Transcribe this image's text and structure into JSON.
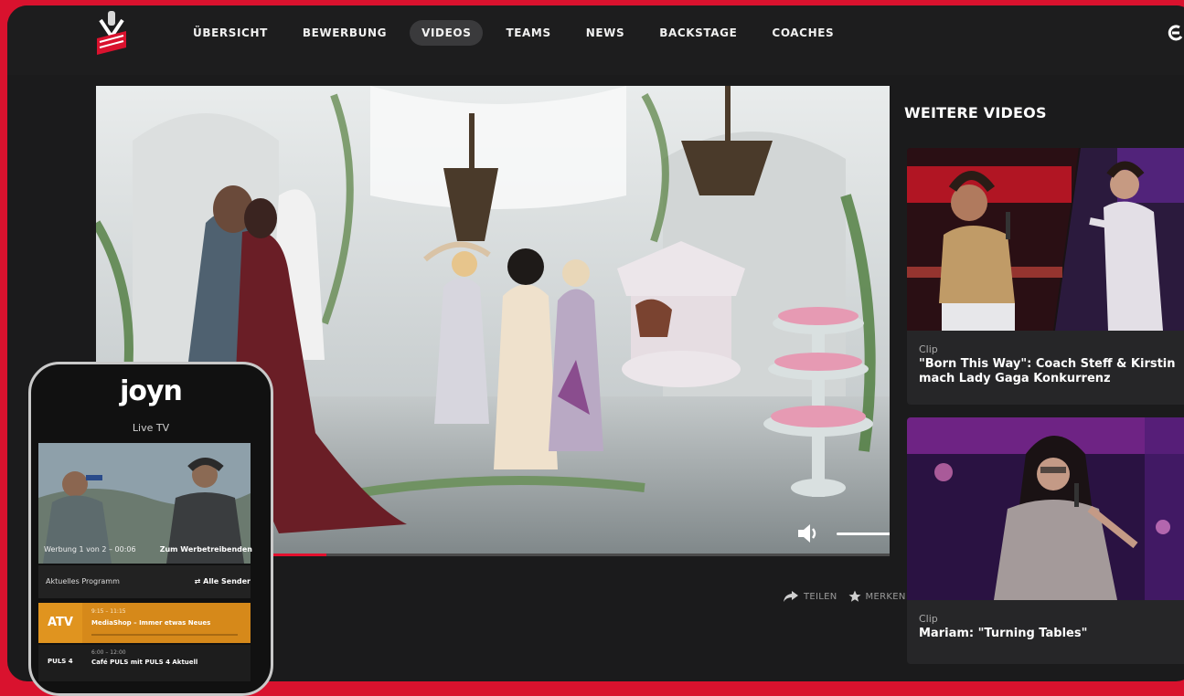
{
  "nav": {
    "items": [
      {
        "label": "ÜBERSICHT"
      },
      {
        "label": "BEWERBUNG"
      },
      {
        "label": "VIDEOS"
      },
      {
        "label": "TEAMS"
      },
      {
        "label": "NEWS"
      },
      {
        "label": "BACKSTAGE"
      },
      {
        "label": "COACHES"
      }
    ],
    "active": "VIDEOS"
  },
  "player": {
    "progress_fraction": 0.29,
    "volume_fraction": 0.86
  },
  "actions": {
    "share_label": "TEILEN",
    "save_label": "MERKEN"
  },
  "sidebar": {
    "title": "WEITERE VIDEOS",
    "cards": [
      {
        "tag": "Clip",
        "title": "\"Born This Way\": Coach Steff & Kirstin mach Lady Gaga Konkurrenz"
      },
      {
        "tag": "Clip",
        "title": "Mariam: \"Turning Tables\""
      }
    ]
  },
  "phone": {
    "logo": "joyn",
    "live_tv": "Live TV",
    "ad_counter": "Werbung 1 von 2 – 00:06",
    "ad_link": "Zum Werbetreibenden",
    "program_label": "Aktuelles Programm",
    "all_channels": "Alle Sender",
    "rows": [
      {
        "channel": "ATV",
        "time": "9:15 – 11:15",
        "title": "MediaShop – Immer etwas Neues"
      },
      {
        "channel": "PULS 4",
        "time": "6:00 – 12:00",
        "title": "Café PULS mit PULS 4 Aktuell"
      }
    ]
  },
  "colors": {
    "brand_red": "#d9122e",
    "frame_bg": "#1b1b1c",
    "nav_active_bg": "#3a3a3c",
    "atv_orange": "#d6891a"
  },
  "icons": {
    "logo": "the-voice-logo",
    "top_right": "avatar-icon",
    "volume": "volume-icon",
    "fullscreen": "fullscreen-icon",
    "share": "share-icon",
    "save": "star-icon",
    "all_channels": "swap-icon"
  }
}
